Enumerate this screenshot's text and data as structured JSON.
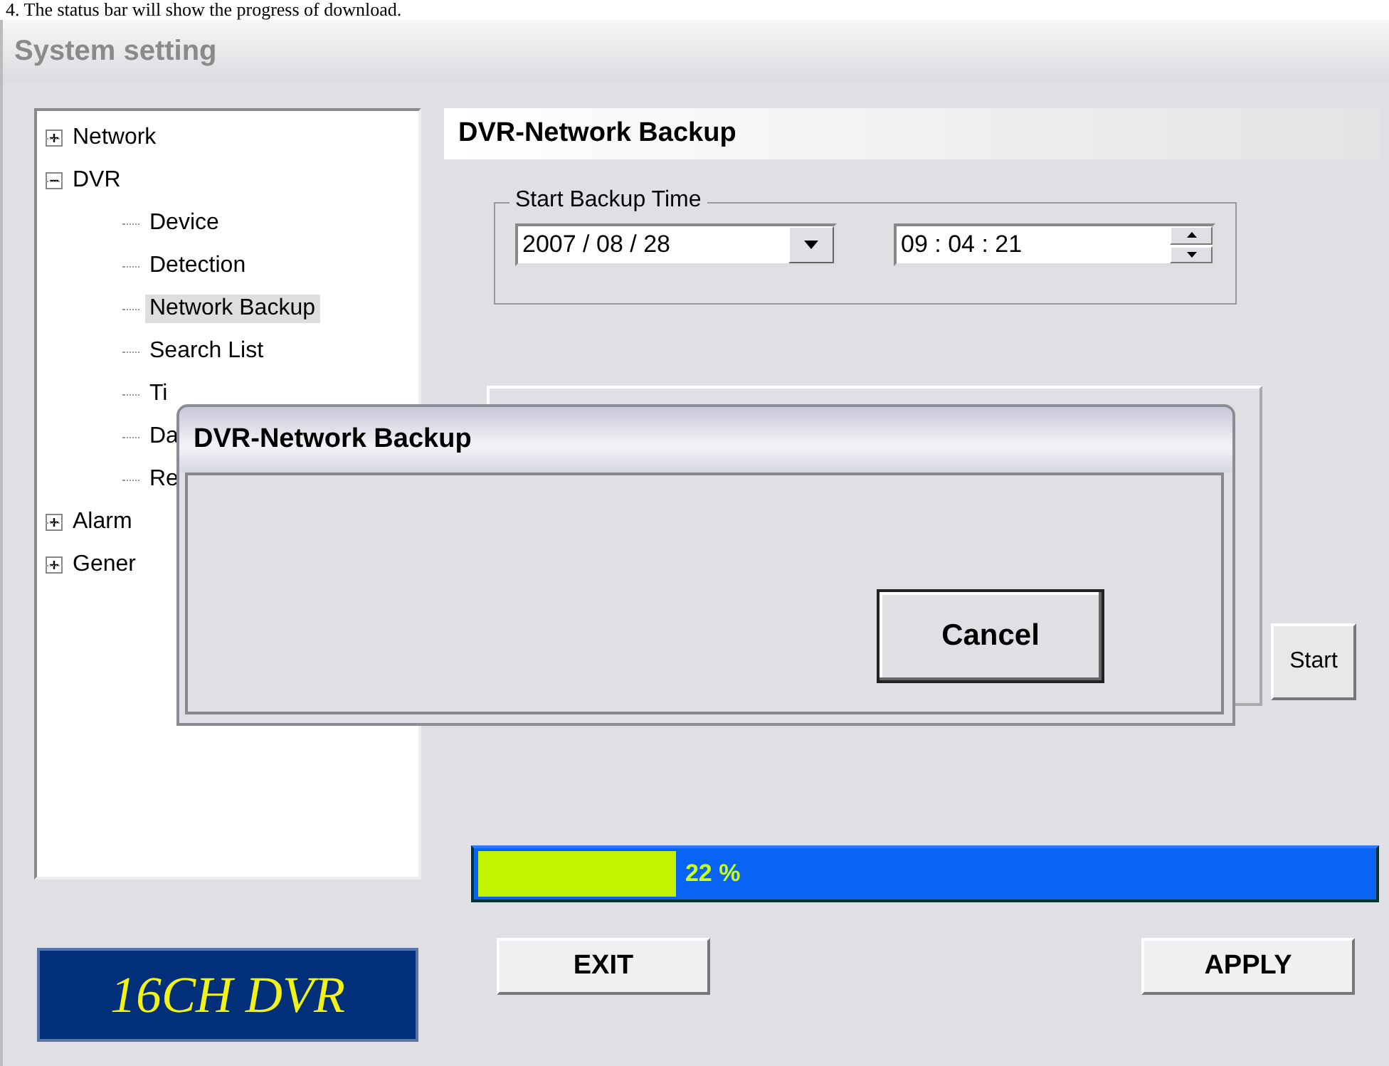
{
  "caption": "4. The status bar will show the progress of download.",
  "window": {
    "title": "System setting"
  },
  "tree": [
    {
      "label": "Network",
      "expanded": false,
      "selected": false
    },
    {
      "label": "DVR",
      "expanded": true,
      "selected": false,
      "children": [
        {
          "label": "Device",
          "selected": false
        },
        {
          "label": "Detection",
          "selected": false
        },
        {
          "label": "Network Backup",
          "selected": true
        },
        {
          "label": "Search List",
          "selected": false
        },
        {
          "label": "Ti",
          "selected": false
        },
        {
          "label": "Da",
          "selected": false
        },
        {
          "label": "Re",
          "selected": false
        }
      ]
    },
    {
      "label": "Alarm",
      "expanded": false,
      "selected": false
    },
    {
      "label": "Gener",
      "expanded": false,
      "selected": false
    }
  ],
  "logo": "16CH DVR",
  "panel": {
    "title": "DVR-Network Backup",
    "group": {
      "label": "Start Backup Time",
      "date": "2007 / 08 / 28",
      "time": "09 : 04 : 21"
    },
    "start_button": "Start",
    "progress": {
      "level": 0.22,
      "reading": "22 %"
    }
  },
  "buttons": [
    "EXIT",
    "APPLY"
  ],
  "dialog": {
    "title": "DVR-Network Backup",
    "button": "Cancel"
  }
}
